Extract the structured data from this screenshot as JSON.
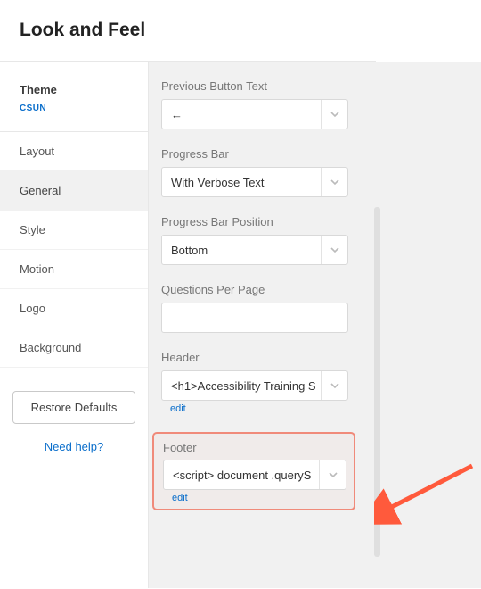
{
  "page_title": "Look and Feel",
  "theme": {
    "label": "Theme",
    "value": "CSUN"
  },
  "sidebar": {
    "items": [
      {
        "label": "Layout",
        "active": false
      },
      {
        "label": "General",
        "active": true
      },
      {
        "label": "Style",
        "active": false
      },
      {
        "label": "Motion",
        "active": false
      },
      {
        "label": "Logo",
        "active": false
      },
      {
        "label": "Background",
        "active": false
      }
    ],
    "restore_label": "Restore Defaults",
    "help_label": "Need help?"
  },
  "fields": {
    "prev_button": {
      "label": "Previous Button Text",
      "value": "←"
    },
    "progress_bar": {
      "label": "Progress Bar",
      "value": "With Verbose Text"
    },
    "progress_pos": {
      "label": "Progress Bar Position",
      "value": "Bottom"
    },
    "per_page": {
      "label": "Questions Per Page",
      "value": ""
    },
    "header": {
      "label": "Header",
      "value": "<h1>Accessibility Training S",
      "edit": "edit"
    },
    "footer": {
      "label": "Footer",
      "value": "<script> document .queryS",
      "edit": "edit"
    }
  },
  "annotation": {
    "arrow_color": "#ff5a3c",
    "highlight_color": "#f08a7a"
  }
}
